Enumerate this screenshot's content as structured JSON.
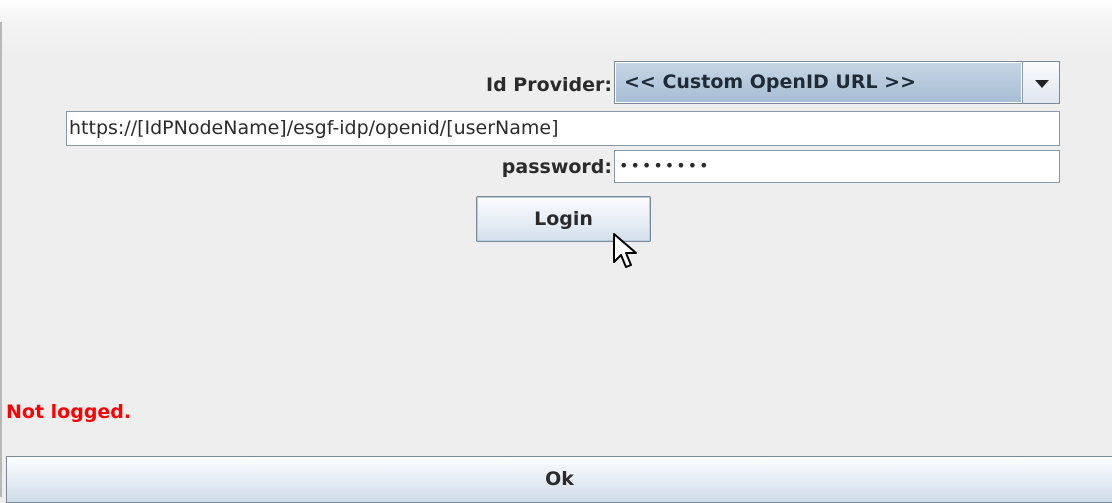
{
  "login_form": {
    "id_provider_label": "Id Provider:",
    "id_provider_selected": "<< Custom OpenID URL >>",
    "openid_url_value": "https://[IdPNodeName]/esgf-idp/openid/[userName]",
    "password_label": "password:",
    "password_value": "••••••••",
    "login_button_label": "Login"
  },
  "status": {
    "text": "Not logged.",
    "color": "#ff0000"
  },
  "dialog": {
    "ok_button_label": "Ok"
  },
  "icons": {
    "dropdown": "chevron-down-icon",
    "cursor": "mouse-pointer-icon"
  },
  "colors": {
    "combo_selection": "#b4c8dc",
    "status_error": "#ff0000",
    "background": "#eeeeee"
  }
}
